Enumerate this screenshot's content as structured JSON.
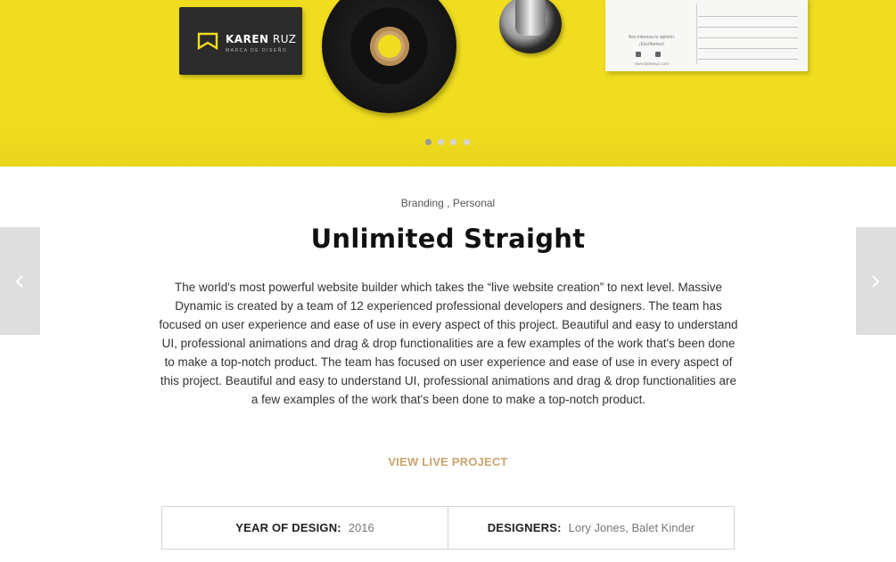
{
  "hero": {
    "card": {
      "brand_bold": "KAREN",
      "brand_light": " RUZ",
      "subtitle": "MARCA DE DISEÑO"
    },
    "postcard": {
      "text": "Nos interesa tu opinión. ¡Escríbenos!",
      "website": "www.karenruz.com"
    },
    "slider": {
      "dot_count": 4,
      "active_index": 0
    }
  },
  "nav": {
    "prev_icon": "chevron-left-icon",
    "next_icon": "chevron-right-icon"
  },
  "project": {
    "categories": [
      "Branding",
      "Personal"
    ],
    "category_separator": " , ",
    "title": "Unlimited Straight",
    "description": "The world's most powerful website builder which takes the “live website creation” to next level. Massive Dynamic is created by a team of 12 experienced professional developers and designers. The team has focused on user experience and ease of use in every aspect of this project. Beautiful and easy to understand UI, professional animations and drag & drop functionalities are a few examples of the work that's been done to make a top-notch product. The team has focused on user experience and ease of use in every aspect of this project. Beautiful and easy to understand UI, professional animations and drag & drop functionalities are a few examples of the work that's been done to make a top-notch product.",
    "cta_label": "VIEW LIVE PROJECT"
  },
  "details": {
    "year_label": "YEAR OF DESIGN:",
    "year_value": "2016",
    "designers_label": "DESIGNERS:",
    "designers_value": "Lory Jones, Balet Kinder"
  },
  "colors": {
    "hero_yellow": "#f1dd1f",
    "accent_gold": "#c9a46e",
    "arrow_bg": "#dedede"
  }
}
